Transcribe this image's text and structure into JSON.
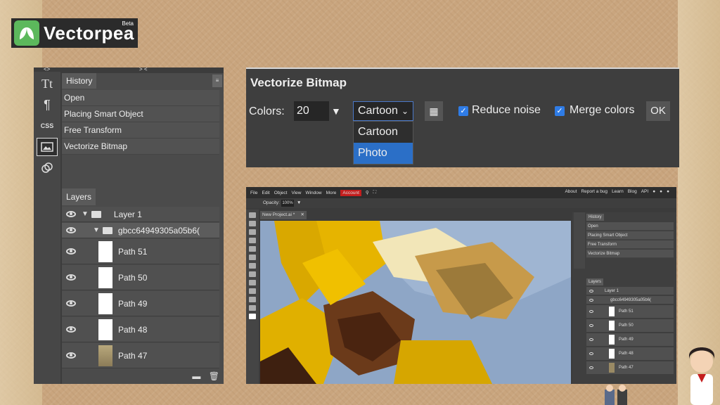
{
  "logo": {
    "name": "Vectorpea",
    "badge": "Beta"
  },
  "left_panel": {
    "collapse_left": "<>",
    "collapse_right": "> <",
    "history": {
      "tab": "History",
      "menu": "≡",
      "items": [
        "Open",
        "Placing Smart Object",
        "Free Transform",
        "Vectorize Bitmap"
      ]
    },
    "layers": {
      "tab": "Layers",
      "items": [
        {
          "label": "Layer 1",
          "kind": "folder"
        },
        {
          "label": "gbcc64949305a05b6(",
          "kind": "folder"
        },
        {
          "label": "Path 51",
          "kind": "path"
        },
        {
          "label": "Path 50",
          "kind": "path"
        },
        {
          "label": "Path 49",
          "kind": "path"
        },
        {
          "label": "Path 48",
          "kind": "path"
        },
        {
          "label": "Path 47",
          "kind": "path-photo"
        }
      ]
    }
  },
  "vectorize": {
    "title": "Vectorize Bitmap",
    "colors_label": "Colors:",
    "colors_value": "20",
    "mode_selected": "Cartoon",
    "mode_options": [
      "Cartoon",
      "Photo"
    ],
    "reduce_noise": "Reduce noise",
    "merge_colors": "Merge colors",
    "ok": "OK"
  },
  "app": {
    "menu": [
      "File",
      "Edit",
      "Object",
      "View",
      "Window",
      "More"
    ],
    "account": "Account",
    "right_links": [
      "About",
      "Report a bug",
      "Learn",
      "Blog",
      "API"
    ],
    "opacity_label": "Opacity:",
    "opacity_value": "100%",
    "doc_tab": "New Project.ai *",
    "history_tab": "History",
    "history_items": [
      "Open",
      "Placing Smart Object",
      "Free Transform",
      "Vectorize Bitmap"
    ],
    "layers_tab": "Layers",
    "layers": [
      "Layer 1",
      "gbcc64949305a05b6(",
      "Path 51",
      "Path 50",
      "Path 49",
      "Path 48",
      "Path 47"
    ]
  }
}
